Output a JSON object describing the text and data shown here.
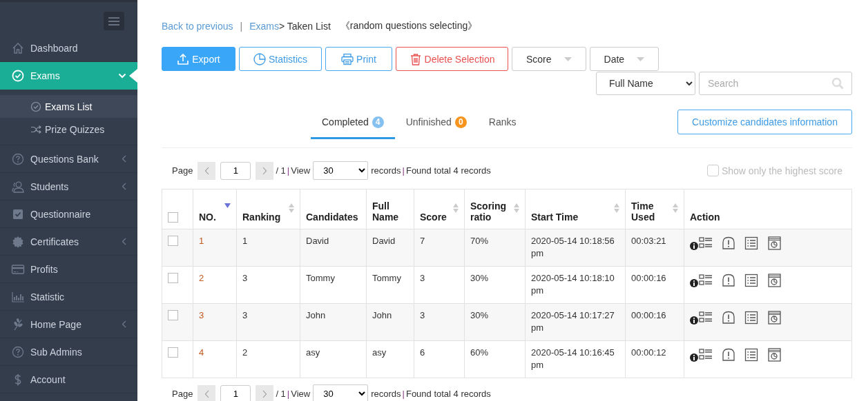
{
  "sidebar": {
    "items": [
      {
        "label": "Dashboard",
        "kind": "link",
        "selected": false
      },
      {
        "label": "Exams",
        "kind": "group",
        "selected": true,
        "expanded": true,
        "children": [
          {
            "label": "Exams List",
            "selected": true
          },
          {
            "label": "Prize Quizzes",
            "selected": false
          }
        ]
      },
      {
        "label": "Questions Bank",
        "kind": "group",
        "selected": false,
        "expanded": false
      },
      {
        "label": "Students",
        "kind": "group",
        "selected": false,
        "expanded": false
      },
      {
        "label": "Questionnaire",
        "kind": "link",
        "selected": false
      },
      {
        "label": "Certificates",
        "kind": "group",
        "selected": false,
        "expanded": false
      },
      {
        "label": "Profits",
        "kind": "link",
        "selected": false
      },
      {
        "label": "Statistic",
        "kind": "link",
        "selected": false
      },
      {
        "label": "Home Page",
        "kind": "group",
        "selected": false,
        "expanded": false
      },
      {
        "label": "Sub Admins",
        "kind": "link",
        "selected": false
      },
      {
        "label": "Account",
        "kind": "link",
        "selected": false
      }
    ]
  },
  "breadcrumb": {
    "back": "Back to previous",
    "separator": "|",
    "parent": "Exams",
    "current": "> Taken List",
    "subtitle": "《random questions selecting》"
  },
  "toolbar": {
    "buttons": [
      {
        "label": "Export",
        "kind": "primary"
      },
      {
        "label": "Statistics",
        "kind": "outline"
      },
      {
        "label": "Print",
        "kind": "outline"
      },
      {
        "label": "Delete Selection",
        "kind": "danger"
      },
      {
        "label": "Score",
        "kind": "dropdown"
      },
      {
        "label": "Date",
        "kind": "dropdown"
      }
    ],
    "filter": {
      "value": "Full Name"
    },
    "search": {
      "placeholder": "Search"
    }
  },
  "tabs": [
    {
      "label": "Completed",
      "badge": "4",
      "color": "#84c1f0",
      "selected": true
    },
    {
      "label": "Unfinished",
      "badge": "0",
      "color": "#f7941d",
      "selected": false
    },
    {
      "label": "Ranks",
      "selected": false
    }
  ],
  "customize_button": "Customize candidates information",
  "pager_top": {
    "page_label": "Page",
    "page": "1",
    "pages": "/ 1",
    "separator": "|",
    "view_label": "View",
    "page_size": "30",
    "records_label": "records",
    "separator_2": "|",
    "total": "Found total 4 records"
  },
  "highest_score": {
    "label": "Show only the highest score",
    "checked": false,
    "disabled": true
  },
  "table": {
    "select_all": false,
    "columns": [
      {
        "label": "NO.",
        "sortable": true,
        "sorted": true
      },
      {
        "label": "Ranking",
        "sortable": true,
        "sorted": false
      },
      {
        "label": "Candidates",
        "sortable": false,
        "sorted": false
      },
      {
        "label": "Full Name",
        "sortable": false,
        "sorted": false
      },
      {
        "label": "Score",
        "sortable": true,
        "sorted": false
      },
      {
        "label": "Scoring ratio",
        "sortable": true,
        "sorted": false
      },
      {
        "label": "Start Time",
        "sortable": true,
        "sorted": false
      },
      {
        "label": "Time Used",
        "sortable": true,
        "sorted": false
      },
      {
        "label": "Action",
        "sortable": false,
        "sorted": false
      }
    ],
    "rows": [
      {
        "checked": false,
        "cells": [
          "1",
          "1",
          "David",
          "David",
          "7",
          "70%",
          "2020-05-14 10:18:56 pm",
          "00:03:21"
        ]
      },
      {
        "checked": false,
        "cells": [
          "2",
          "3",
          "Tommy",
          "Tommy",
          "3",
          "30%",
          "2020-05-14 10:18:10 pm",
          "00:00:16"
        ]
      },
      {
        "checked": false,
        "cells": [
          "3",
          "3",
          "John",
          "John",
          "3",
          "30%",
          "2020-05-14 10:17:27 pm",
          "00:00:16"
        ]
      },
      {
        "checked": false,
        "cells": [
          "4",
          "2",
          "asy",
          "asy",
          "6",
          "60%",
          "2020-05-14 10:16:45 pm",
          "00:00:12"
        ]
      }
    ]
  },
  "pager_bottom": {
    "page_label": "Page",
    "page": "1",
    "pages": "/ 1",
    "separator": "|",
    "view_label": "View",
    "page_size": "30",
    "records_label": "records",
    "separator_2": "|",
    "total": "Found total 4 records"
  }
}
